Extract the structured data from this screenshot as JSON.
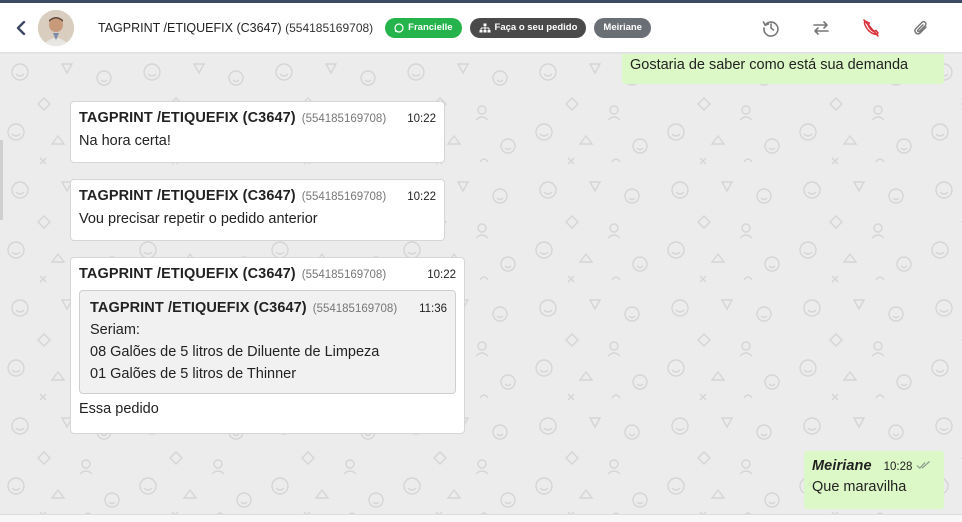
{
  "header": {
    "contact_name": "TAGPRINT /ETIQUEFIX (C3647)",
    "contact_phone": "(554185169708)",
    "tags": [
      {
        "label": "Francielle",
        "color": "#25b34b"
      },
      {
        "label": "Faça o seu pedido",
        "color": "#4a4a4a"
      },
      {
        "label": "Meiriane",
        "color": "#6a6f75"
      }
    ],
    "icons": [
      "history-icon",
      "transfer-icon",
      "end-call-icon",
      "attachment-icon"
    ]
  },
  "messages": [
    {
      "type": "outgoing-partial",
      "text": "Gostaria de saber como está sua demanda"
    },
    {
      "type": "incoming",
      "author": "TAGPRINT /ETIQUEFIX (C3647)",
      "phone": "(554185169708)",
      "time": "10:22",
      "text": "Na hora certa!"
    },
    {
      "type": "incoming",
      "author": "TAGPRINT /ETIQUEFIX (C3647)",
      "phone": "(554185169708)",
      "time": "10:22",
      "text": "Vou precisar repetir o pedido anterior"
    },
    {
      "type": "incoming-reply",
      "author": "TAGPRINT /ETIQUEFIX (C3647)",
      "phone": "(554185169708)",
      "time": "10:22",
      "quoted": {
        "author": "TAGPRINT /ETIQUEFIX (C3647)",
        "phone": "(554185169708)",
        "time": "11:36",
        "lines": [
          "Seriam:",
          "08 Galões de 5 litros de Diluente de Limpeza",
          "01 Galões de 5 litros de Thinner"
        ]
      },
      "text": "Essa pedido"
    },
    {
      "type": "outgoing",
      "author": "Meiriane",
      "time": "10:28",
      "text": "Que maravilha",
      "status_icon": "double-check-icon"
    }
  ],
  "colors": {
    "outgoing_bubble": "#dcf8c6",
    "incoming_bubble": "#ffffff",
    "header_bar": "#3d4a63"
  }
}
